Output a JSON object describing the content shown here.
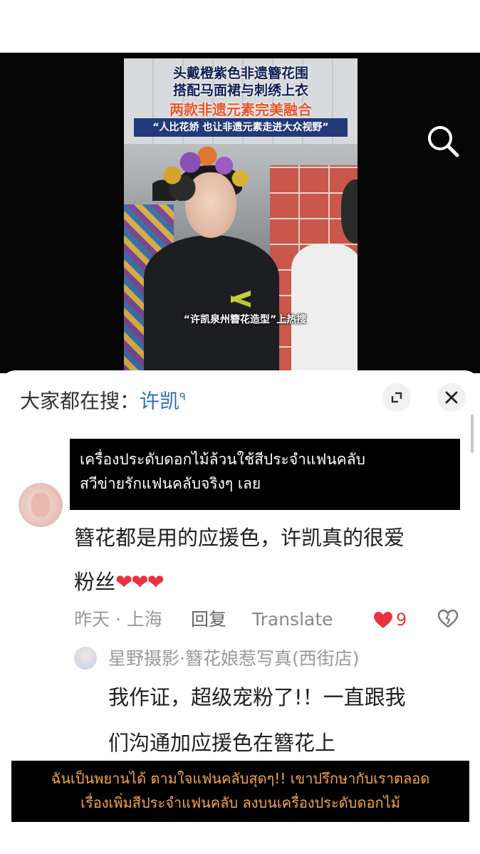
{
  "video": {
    "caption_line1": "头戴橙紫色非遗簪花围",
    "caption_line2": "搭配马面裙与刺绣上衣",
    "caption_line3": "两款非遗元素完美融合",
    "caption_quote": "“人比花娇 也让非遗元素走进大众视野”",
    "caption_bottom": "“许凯泉州簪花造型”上热搜",
    "search_icon": "search-icon"
  },
  "sheet": {
    "search_prefix": "大家都在搜：",
    "search_term": "许凯",
    "search_sup": "ᑫ",
    "expand_icon": "expand-icon",
    "close_icon": "close-icon"
  },
  "translation_top": {
    "line1": "เครื่องประดับดอกไม้ล้วนใช้สีประจำแฟนคลับ",
    "line2": "สวีข่ายรักแฟนคลับจริงๆ เลย"
  },
  "comment": {
    "line1": "簪花都是用的应援色，许凯真的很爱",
    "line2": "粉丝",
    "hearts": "❤❤❤",
    "date": "昨天 · 上海",
    "reply": "回复",
    "translate": "Translate",
    "likes": "9"
  },
  "reply": {
    "user": "星野摄影·簪花娘惹写真(西街店)",
    "line1": "我作证，超级宠粉了!！一直跟我",
    "line2": "们沟通加应援色在簪花上"
  },
  "translation_bottom": {
    "line1": "ฉันเป็นพยานได้ ตามใจแฟนคลับสุดๆ!! เขาปรึกษากับเราตลอด",
    "line2": "เรื่องเพิ่มสีประจำแฟนคลับ ลงบนเครื่องประดับดอกไม้"
  },
  "colors": {
    "accent_blue": "#2f6fb7",
    "like_red": "#e8323f",
    "thai_bottom": "#f3a44c"
  }
}
